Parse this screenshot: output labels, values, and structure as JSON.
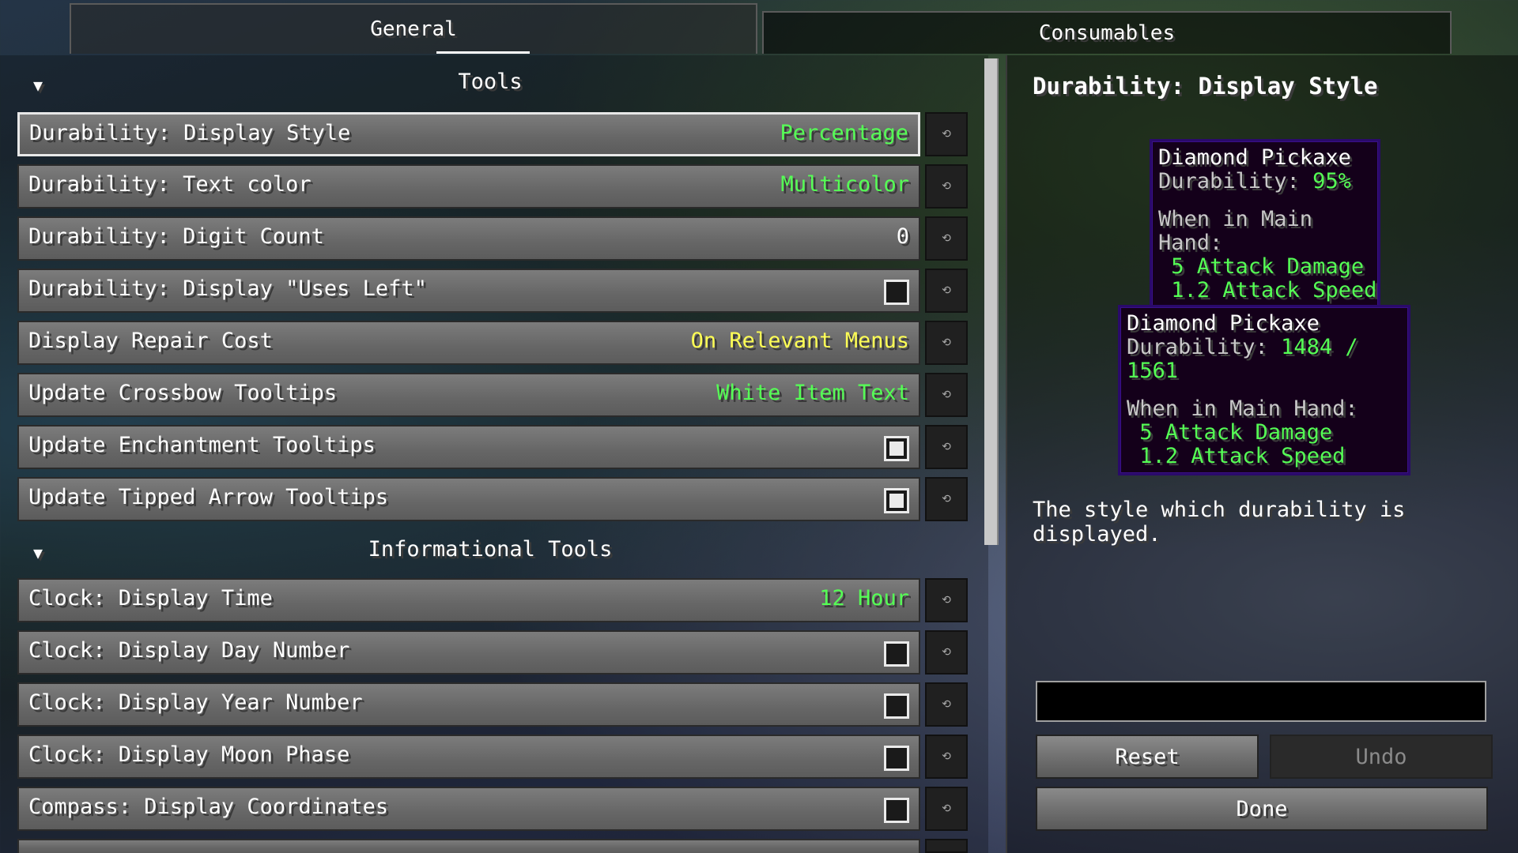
{
  "tabs": [
    {
      "label": "General",
      "active": true
    },
    {
      "label": "Consumables",
      "active": false
    }
  ],
  "groups": [
    {
      "title": "Tools"
    },
    {
      "title": "Informational Tools"
    }
  ],
  "rows": [
    {
      "label": "Durability: Display Style",
      "value": "Percentage",
      "type": "value",
      "color": "#55ff55",
      "selected": true
    },
    {
      "label": "Durability: Text color",
      "value": "Multicolor",
      "type": "value",
      "color": "#55ff55"
    },
    {
      "label": "Durability: Digit Count",
      "value": "0",
      "type": "value",
      "color": "#ffffff"
    },
    {
      "label": "Durability: Display \"Uses Left\"",
      "type": "check",
      "checked": false
    },
    {
      "label": "Display Repair Cost",
      "value": "On Relevant Menus",
      "type": "value",
      "color": "#ffff55"
    },
    {
      "label": "Update Crossbow Tooltips",
      "value": "White Item Text",
      "type": "value",
      "color": "#55ff55"
    },
    {
      "label": "Update Enchantment Tooltips",
      "type": "check",
      "checked": true
    },
    {
      "label": "Update Tipped Arrow Tooltips",
      "type": "check",
      "checked": true
    },
    {
      "label": "Clock: Display Time",
      "value": "12 Hour",
      "type": "value",
      "color": "#55ff55"
    },
    {
      "label": "Clock: Display Day Number",
      "type": "check",
      "checked": false
    },
    {
      "label": "Clock: Display Year Number",
      "type": "check",
      "checked": false
    },
    {
      "label": "Clock: Display Moon Phase",
      "type": "check",
      "checked": false
    },
    {
      "label": "Compass: Display Coordinates",
      "type": "check",
      "checked": false
    }
  ],
  "reset_icon": "reset-icon",
  "right": {
    "title": "Durability: Display Style",
    "tooltip1": {
      "name": "Diamond Pickaxe",
      "durability_label": "Durability: ",
      "durability_value": "95%",
      "main_hand": "When in Main Hand:",
      "attack_damage": " 5 Attack Damage",
      "attack_speed": " 1.2 Attack Speed"
    },
    "tooltip2": {
      "name": "Diamond Pickaxe",
      "durability_label": "Durability: ",
      "durability_value": "1484 / 1561",
      "main_hand": "When in Main Hand:",
      "attack_damage": " 5 Attack Damage",
      "attack_speed": " 1.2 Attack Speed"
    },
    "description": "The style which durability is displayed.",
    "search_value": "",
    "reset_label": "Reset",
    "undo_label": "Undo",
    "done_label": "Done"
  }
}
